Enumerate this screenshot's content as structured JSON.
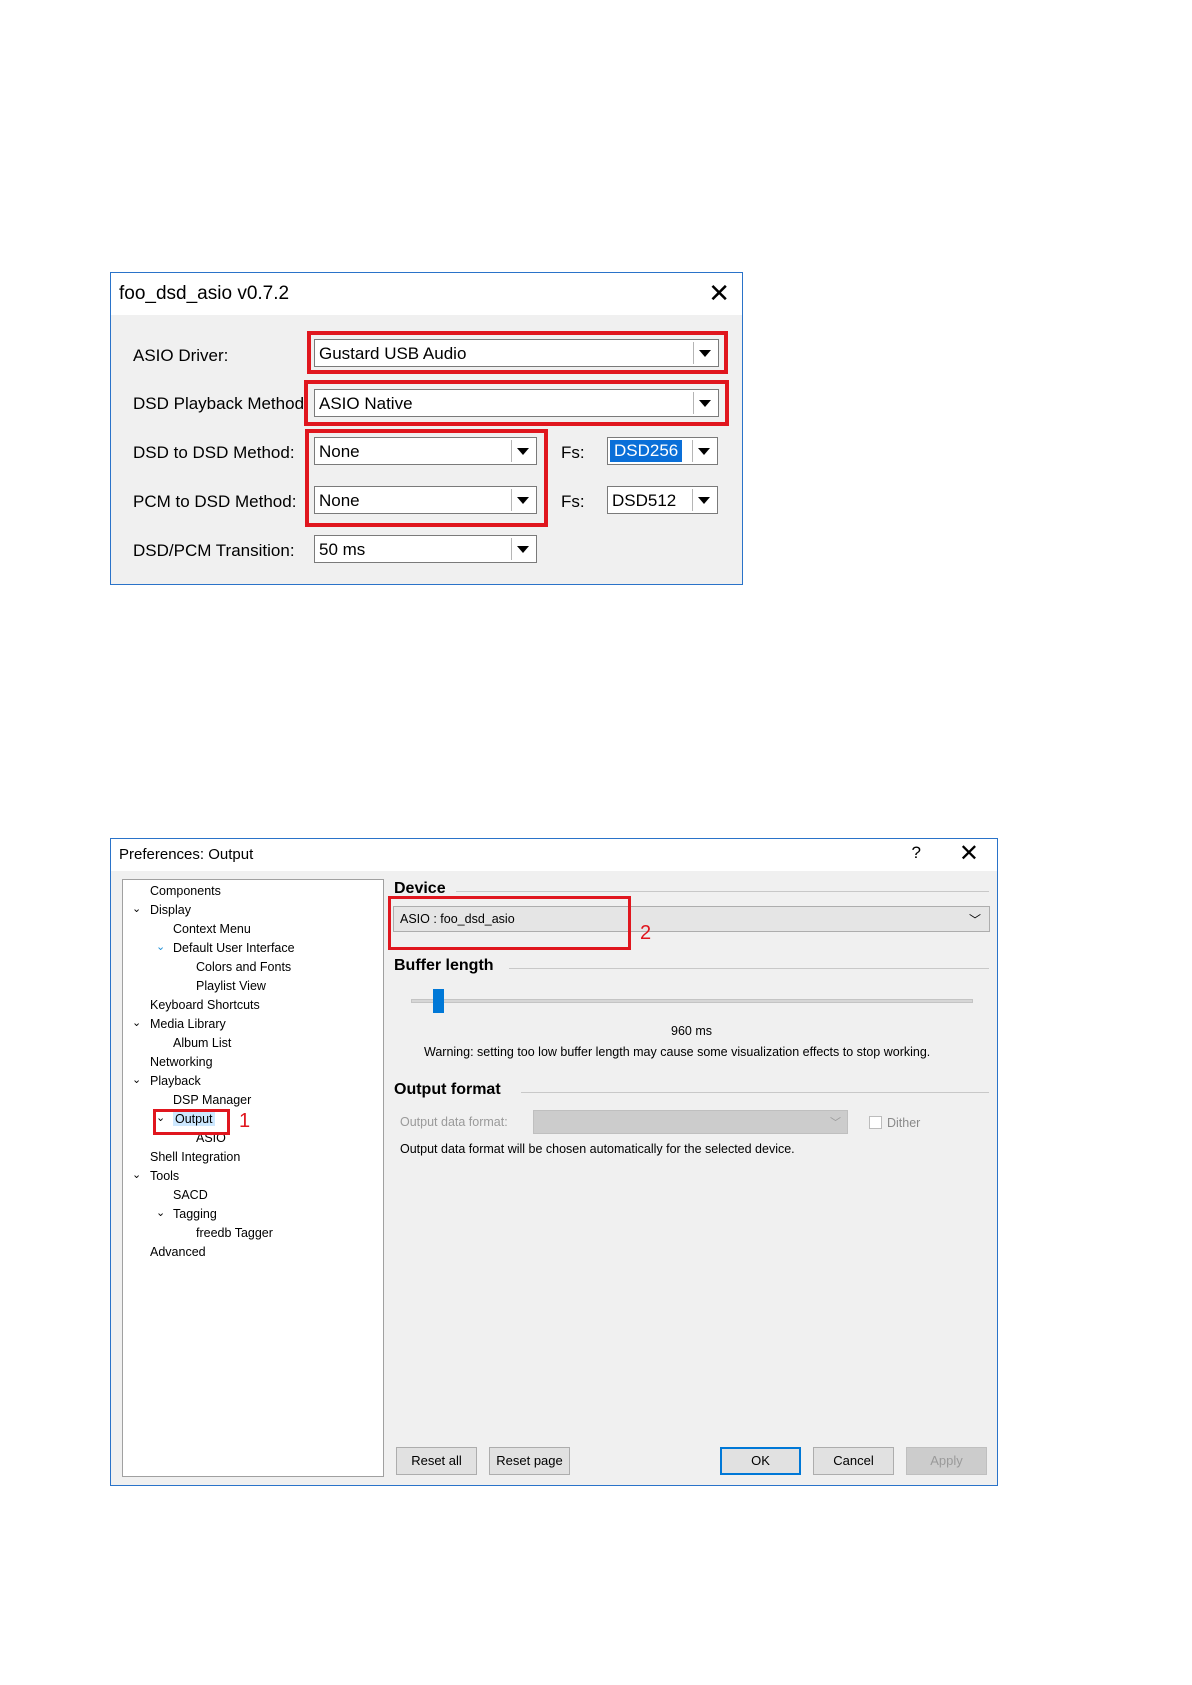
{
  "dialog1": {
    "title": "foo_dsd_asio v0.7.2",
    "close_glyph": "✕",
    "rows": [
      {
        "label": "ASIO Driver:",
        "value": "Gustard USB Audio"
      },
      {
        "label": "DSD Playback Method:",
        "value": "ASIO Native"
      },
      {
        "label": "DSD to DSD Method:",
        "value": "None",
        "fs_label": "Fs:",
        "fs_value": "DSD256"
      },
      {
        "label": "PCM to DSD Method:",
        "value": "None",
        "fs_label": "Fs:",
        "fs_value": "DSD512"
      },
      {
        "label": "DSD/PCM Transition:",
        "value": "50 ms"
      }
    ]
  },
  "dialog2": {
    "title": "Preferences: Output",
    "help_glyph": "?",
    "close_glyph": "✕",
    "tree": [
      "Components",
      "Display",
      "Context Menu",
      "Default User Interface",
      "Colors and Fonts",
      "Playlist View",
      "Keyboard Shortcuts",
      "Media Library",
      "Album List",
      "Networking",
      "Playback",
      "DSP Manager",
      "Output",
      "ASIO",
      "Shell Integration",
      "Tools",
      "SACD",
      "Tagging",
      "freedb Tagger",
      "Advanced"
    ],
    "device": {
      "heading": "Device",
      "value": "ASIO : foo_dsd_asio"
    },
    "buffer": {
      "heading": "Buffer length",
      "value_text": "960 ms",
      "slider_fraction": 0.04,
      "warning": "Warning: setting too low buffer length may cause some visualization effects to stop working."
    },
    "output_format": {
      "heading": "Output format",
      "data_format_label": "Output data format:",
      "dither_label": "Dither",
      "note": "Output data format will be chosen automatically for the selected device."
    },
    "buttons": {
      "reset_all": "Reset all",
      "reset_page": "Reset page",
      "ok": "OK",
      "cancel": "Cancel",
      "apply": "Apply"
    },
    "markers": {
      "one": "1",
      "two": "2"
    }
  },
  "colors": {
    "highlight_red": "#e0161e",
    "accent_blue": "#0078d7"
  }
}
